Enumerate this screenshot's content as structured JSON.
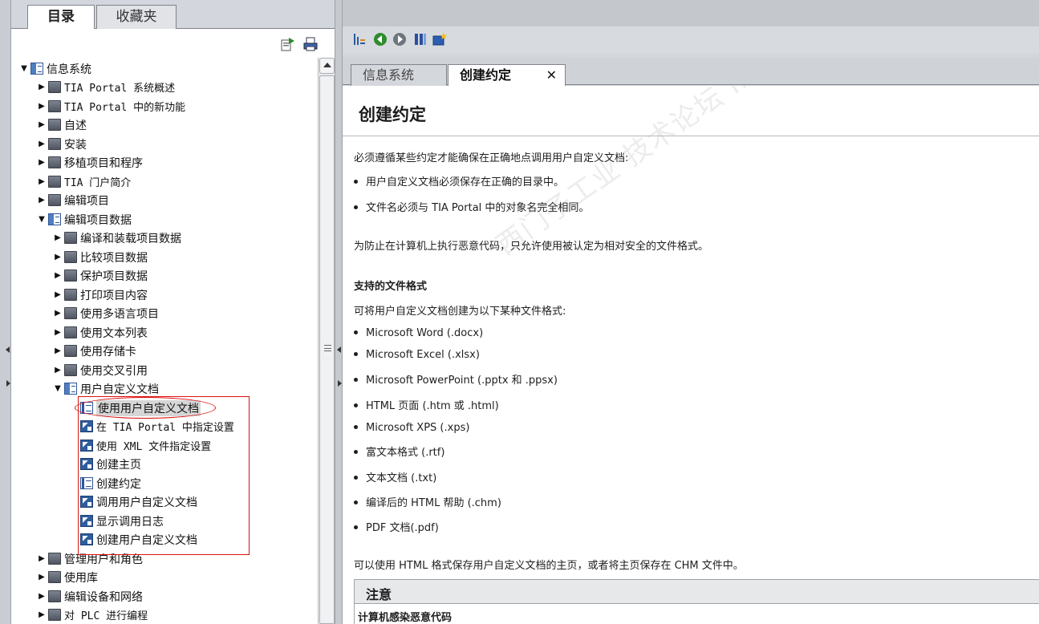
{
  "left": {
    "tabs": {
      "index": "目录",
      "favorites": "收藏夹"
    },
    "tree": [
      {
        "label": "信息系统",
        "icon": "book-open",
        "arrow": "down"
      },
      {
        "label": "TIA Portal 系统概述",
        "icon": "book",
        "arrow": "right"
      },
      {
        "label": "TIA Portal 中的新功能",
        "icon": "book",
        "arrow": "right"
      },
      {
        "label": "自述",
        "icon": "book",
        "arrow": "right"
      },
      {
        "label": "安装",
        "icon": "book",
        "arrow": "right"
      },
      {
        "label": "移植项目和程序",
        "icon": "book",
        "arrow": "right"
      },
      {
        "label": "TIA 门户简介",
        "icon": "book",
        "arrow": "right"
      },
      {
        "label": "编辑项目",
        "icon": "book",
        "arrow": "right"
      },
      {
        "label": "编辑项目数据",
        "icon": "book-open",
        "arrow": "down"
      },
      {
        "label": "编译和装载项目数据",
        "icon": "book",
        "arrow": "right"
      },
      {
        "label": "比较项目数据",
        "icon": "book",
        "arrow": "right"
      },
      {
        "label": "保护项目数据",
        "icon": "book",
        "arrow": "right"
      },
      {
        "label": "打印项目内容",
        "icon": "book",
        "arrow": "right"
      },
      {
        "label": "使用多语言项目",
        "icon": "book",
        "arrow": "right"
      },
      {
        "label": "使用文本列表",
        "icon": "book",
        "arrow": "right"
      },
      {
        "label": "使用存储卡",
        "icon": "book",
        "arrow": "right"
      },
      {
        "label": "使用交叉引用",
        "icon": "book",
        "arrow": "right"
      },
      {
        "label": "用户自定义文档",
        "icon": "book-open",
        "arrow": "down"
      },
      {
        "label": "使用用户自定义文档",
        "icon": "page",
        "arrow": ""
      },
      {
        "label": "在 TIA Portal 中指定设置",
        "icon": "link",
        "arrow": ""
      },
      {
        "label": "使用 XML 文件指定设置",
        "icon": "link",
        "arrow": ""
      },
      {
        "label": "创建主页",
        "icon": "link",
        "arrow": ""
      },
      {
        "label": "创建约定",
        "icon": "page",
        "arrow": ""
      },
      {
        "label": "调用用户自定义文档",
        "icon": "link",
        "arrow": ""
      },
      {
        "label": "显示调用日志",
        "icon": "link",
        "arrow": ""
      },
      {
        "label": "创建用户自定义文档",
        "icon": "link",
        "arrow": ""
      },
      {
        "label": "管理用户和角色",
        "icon": "book",
        "arrow": "right"
      },
      {
        "label": "使用库",
        "icon": "book",
        "arrow": "right"
      },
      {
        "label": "编辑设备和网络",
        "icon": "book",
        "arrow": "right"
      },
      {
        "label": "对 PLC 进行编程",
        "icon": "book",
        "arrow": "right"
      }
    ]
  },
  "right": {
    "tabs": {
      "info": "信息系统",
      "create": "创建约定",
      "close": "✕"
    },
    "title": "创建约定",
    "intro": "必须遵循某些约定才能确保在正确地点调用用户自定义文档:",
    "intro_bullets": [
      "用户自定义文档必须保存在正确的目录中。",
      "文件名必须与 TIA Portal 中的对象名完全相同。"
    ],
    "security": "为防止在计算机上执行恶意代码，只允许使用被认定为相对安全的文件格式。",
    "formats_heading": "支持的文件格式",
    "formats_intro": "可将用户自定义文档创建为以下某种文件格式:",
    "formats": [
      "Microsoft Word (.docx)",
      "Microsoft Excel (.xlsx)",
      "Microsoft PowerPoint (.pptx 和 .ppsx)",
      "HTML 页面 (.htm 或 .html)",
      "Microsoft XPS (.xps)",
      "富文本格式 (.rtf)",
      "文本文档 (.txt)",
      "编译后的 HTML 帮助 (.chm)",
      "PDF 文档(.pdf)"
    ],
    "html_note": "可以使用 HTML 格式保存用户自定义文档的主页，或者将主页保存在 CHM 文件中。",
    "note_title": "注意",
    "note_sub": "计算机感染恶意代码",
    "watermark": "西门子工业 技术论坛 industry.siemens.com/cs"
  },
  "colors": {
    "highlight": "#dd1111",
    "accent": "#2f5597"
  }
}
